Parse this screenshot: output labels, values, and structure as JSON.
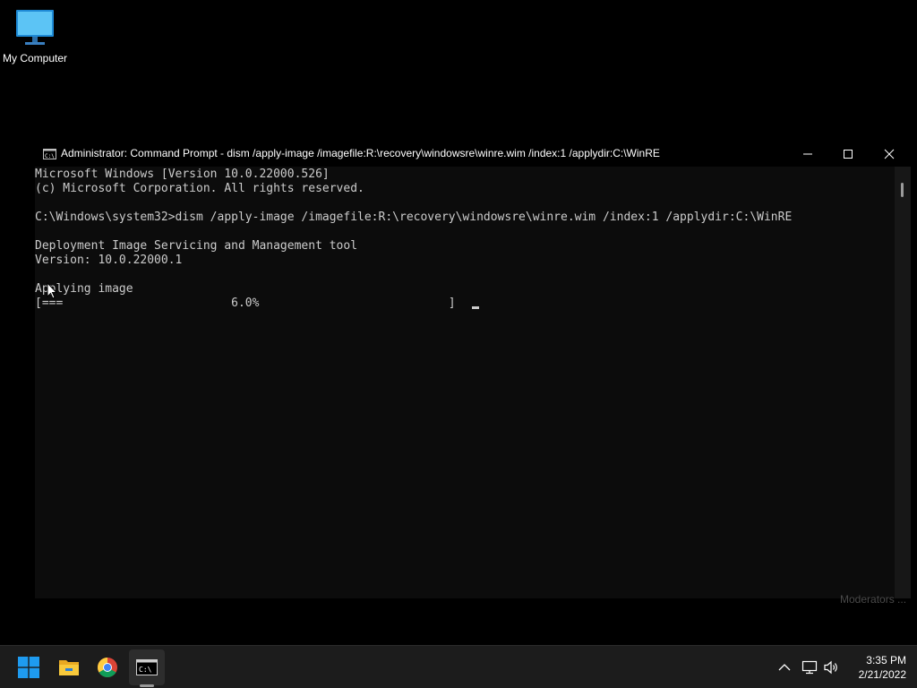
{
  "desktop": {
    "icons": [
      {
        "label": "My Computer",
        "icon": "monitor-icon"
      }
    ],
    "watermark": "Moderators ..."
  },
  "window": {
    "title": "Administrator: Command Prompt - dism  /apply-image /imagefile:R:\\recovery\\windowsre\\winre.wim /index:1 /applydir:C:\\WinRE",
    "icon": "cmd-icon",
    "controls": [
      "minimize-icon",
      "maximize-icon",
      "close-icon"
    ],
    "console_lines": [
      "Microsoft Windows [Version 10.0.22000.526]",
      "(c) Microsoft Corporation. All rights reserved.",
      "",
      "C:\\Windows\\system32>dism /apply-image /imagefile:R:\\recovery\\windowsre\\winre.wim /index:1 /applydir:C:\\WinRE",
      "",
      "Deployment Image Servicing and Management tool",
      "Version: 10.0.22000.1",
      "",
      "Applying image",
      "[===                        6.0%                           ]"
    ],
    "progress_percent": 6.0
  },
  "taskbar": {
    "apps": [
      {
        "name": "start",
        "icon": "windows-logo-icon"
      },
      {
        "name": "file-explorer",
        "icon": "folder-icon"
      },
      {
        "name": "chrome",
        "icon": "chrome-icon"
      },
      {
        "name": "command-prompt",
        "icon": "cmd-icon",
        "active": true
      }
    ],
    "tray": {
      "icons": [
        "chevron-up-icon",
        "network-icon",
        "volume-icon"
      ],
      "time": "3:35 PM",
      "date": "2/21/2022"
    }
  },
  "colors": {
    "desktop_background": "#000000",
    "console_background": "#0c0c0c",
    "console_text": "#cccccc",
    "taskbar_background": "#1c1c1c",
    "accent_blue": "#0078d4"
  }
}
